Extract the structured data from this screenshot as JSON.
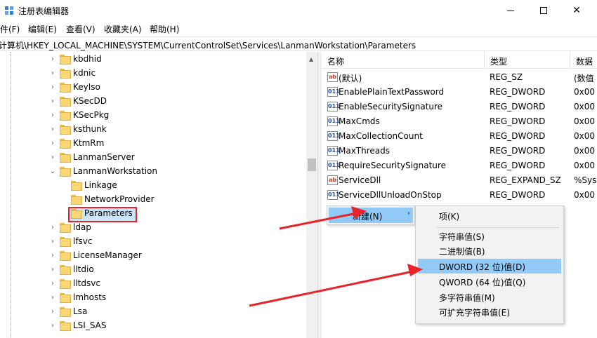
{
  "window": {
    "title": "注册表编辑器",
    "minimize_glyph": "",
    "close_glyph": "✕"
  },
  "menu": [
    "文件(F)",
    "编辑(E)",
    "查看(V)",
    "收藏夹(A)",
    "帮助(H)"
  ],
  "address": "计算机\\HKEY_LOCAL_MACHINE\\SYSTEM\\CurrentControlSet\\Services\\LanmanWorkstation\\Parameters",
  "tree": {
    "expander_collapsed": "›",
    "expander_expanded": "⌄",
    "items": [
      {
        "label": "kbdhid",
        "level": 0,
        "state": "collapsed"
      },
      {
        "label": "kdnic",
        "level": 0,
        "state": "collapsed"
      },
      {
        "label": "KeyIso",
        "level": 0,
        "state": "collapsed"
      },
      {
        "label": "KSecDD",
        "level": 0,
        "state": "collapsed"
      },
      {
        "label": "KSecPkg",
        "level": 0,
        "state": "collapsed"
      },
      {
        "label": "ksthunk",
        "level": 0,
        "state": "collapsed"
      },
      {
        "label": "KtmRm",
        "level": 0,
        "state": "collapsed"
      },
      {
        "label": "LanmanServer",
        "level": 0,
        "state": "collapsed"
      },
      {
        "label": "LanmanWorkstation",
        "level": 0,
        "state": "expanded"
      },
      {
        "label": "Linkage",
        "level": 1,
        "state": "leaf"
      },
      {
        "label": "NetworkProvider",
        "level": 1,
        "state": "leaf"
      },
      {
        "label": "Parameters",
        "level": 1,
        "state": "selected"
      },
      {
        "label": "ldap",
        "level": 0,
        "state": "collapsed"
      },
      {
        "label": "lfsvc",
        "level": 0,
        "state": "collapsed"
      },
      {
        "label": "LicenseManager",
        "level": 0,
        "state": "collapsed"
      },
      {
        "label": "lltdio",
        "level": 0,
        "state": "collapsed"
      },
      {
        "label": "lltdsvc",
        "level": 0,
        "state": "collapsed"
      },
      {
        "label": "lmhosts",
        "level": 0,
        "state": "collapsed"
      },
      {
        "label": "Lsa",
        "level": 0,
        "state": "collapsed"
      },
      {
        "label": "LSI_SAS",
        "level": 0,
        "state": "collapsed"
      }
    ]
  },
  "columns": {
    "name": "名称",
    "type": "类型",
    "data": "数据"
  },
  "values": [
    {
      "name": "(默认)",
      "type": "REG_SZ",
      "data": "(数值",
      "icon": "sz"
    },
    {
      "name": "EnablePlainTextPassword",
      "type": "REG_DWORD",
      "data": "0x00",
      "icon": "dw"
    },
    {
      "name": "EnableSecuritySignature",
      "type": "REG_DWORD",
      "data": "0x00",
      "icon": "dw"
    },
    {
      "name": "MaxCmds",
      "type": "REG_DWORD",
      "data": "0x00",
      "icon": "dw"
    },
    {
      "name": "MaxCollectionCount",
      "type": "REG_DWORD",
      "data": "0x00",
      "icon": "dw"
    },
    {
      "name": "MaxThreads",
      "type": "REG_DWORD",
      "data": "0x00",
      "icon": "dw"
    },
    {
      "name": "RequireSecuritySignature",
      "type": "REG_DWORD",
      "data": "0x00",
      "icon": "dw"
    },
    {
      "name": "ServiceDll",
      "type": "REG_EXPAND_SZ",
      "data": "%Sys",
      "icon": "sz"
    },
    {
      "name": "ServiceDllUnloadOnStop",
      "type": "REG_DWORD",
      "data": "0x00",
      "icon": "dw"
    }
  ],
  "icon_glyphs": {
    "sz": "ab",
    "dw": "011"
  },
  "context_menu": {
    "new_label": "新建(N)",
    "submenu_arrow": "›",
    "submenu": [
      {
        "label": "项(K)",
        "highlighted": false
      },
      {
        "label": "字符串值(S)",
        "highlighted": false
      },
      {
        "label": "二进制值(B)",
        "highlighted": false
      },
      {
        "label": "DWORD (32 位)值(D)",
        "highlighted": true
      },
      {
        "label": "QWORD (64 位)值(Q)",
        "highlighted": false
      },
      {
        "label": "多字符串值(M)",
        "highlighted": false
      },
      {
        "label": "可扩充字符串值(E)",
        "highlighted": false
      }
    ]
  },
  "colors": {
    "annotation_red": "#e8232a",
    "selection_blue": "#cce4f7",
    "menu_highlight": "#91c9f7"
  }
}
